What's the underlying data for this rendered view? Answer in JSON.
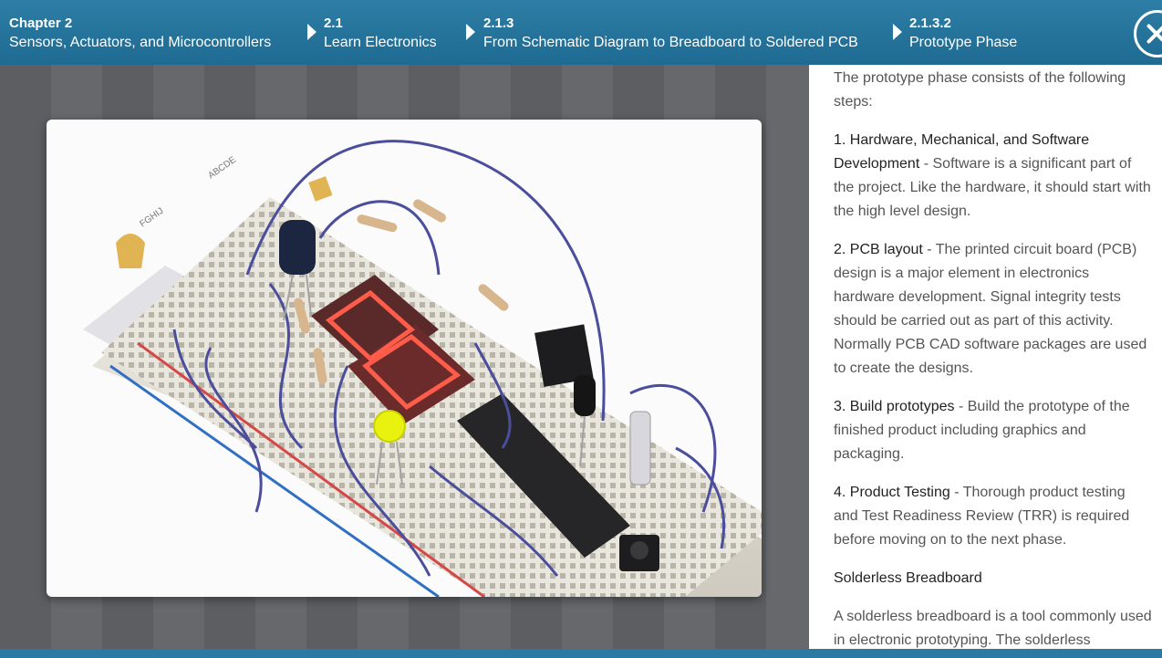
{
  "breadcrumb": {
    "chapter": {
      "num": "Chapter 2",
      "title": "Sensors, Actuators, and Microcontrollers"
    },
    "section": {
      "num": "2.1",
      "title": "Learn Electronics"
    },
    "subsection": {
      "num": "2.1.3",
      "title": "From Schematic Diagram to Breadboard to Soldered PCB"
    },
    "page": {
      "num": "2.1.3.2",
      "title": "Prototype Phase"
    }
  },
  "close_icon": "close-icon",
  "figure": {
    "alt": "breadboard prototype image",
    "labels": {
      "letters_top": "ABCDE",
      "letters_bottom": "FGHIJ"
    }
  },
  "content": {
    "intro": "The prototype phase consists of the following steps:",
    "steps": [
      {
        "title": "1. Hardware, Mechanical, and Software Development",
        "body": " - Software is a significant part of the project. Like the hardware, it should start with the high level design."
      },
      {
        "title": "2. PCB layout",
        "body": " - The printed circuit board (PCB) design is a major element in electronics hardware development. Signal integrity tests should be carried out as part of this activity. Normally PCB CAD software packages are used to create the designs."
      },
      {
        "title": "3. Build prototypes",
        "body": " - Build the prototype of the finished product including graphics and packaging."
      },
      {
        "title": "4. Product Testing",
        "body": " - Thorough product testing and Test Readiness Review (TRR) is required before moving on to the next phase."
      }
    ],
    "subheading": "Solderless Breadboard",
    "closing": "A solderless breadboard is a tool commonly used in electronic prototyping. The solderless"
  },
  "colors": {
    "header": "#1e6a92",
    "accent": "#35a4d5",
    "background": "#606266"
  }
}
